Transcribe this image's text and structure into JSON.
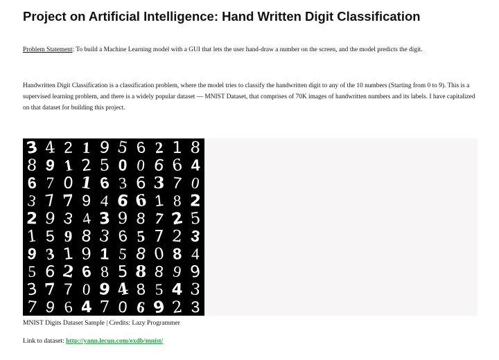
{
  "doc": {
    "title": "Project on Artificial Intelligence: Hand Written Digit Classification",
    "problem_label": "Problem Statement",
    "problem_text": ": To build a Machine Learning model with a GUI that lets the user hand-draw a number on the screen, and the model predicts the digit.",
    "description": "Handwritten Digit Classification is a classification problem, where the model tries to classify the handwritten digit to any of the 10 numbers (Starting from 0 to 9). This is a supervised learning problem, and there is a widely popular dataset — MNIST Dataset, that comprises of 70K images of handwritten numbers and its labels. I have capitalized on that dataset for building this project.",
    "caption": "MNIST Digits Dataset Sample | Credits: Lazy Programmer",
    "link_prefix": "Link to dataset: ",
    "link_text": "http://yann.lecun.com/exdb/mnist/"
  },
  "mnist_grid": {
    "rows": [
      [
        "3",
        "4",
        "2",
        "1",
        "9",
        "5",
        "6",
        "2",
        "1",
        "8"
      ],
      [
        "8",
        "9",
        "1",
        "2",
        "5",
        "0",
        "0",
        "6",
        "6",
        "4"
      ],
      [
        "6",
        "7",
        "0",
        "1",
        "6",
        "3",
        "6",
        "3",
        "7",
        "0"
      ],
      [
        "3",
        "7",
        "7",
        "9",
        "4",
        "6",
        "6",
        "1",
        "8",
        "2"
      ],
      [
        "2",
        "9",
        "3",
        "4",
        "3",
        "9",
        "8",
        "7",
        "2",
        "5"
      ],
      [
        "1",
        "5",
        "9",
        "8",
        "3",
        "6",
        "5",
        "7",
        "2",
        "3"
      ],
      [
        "9",
        "3",
        "1",
        "9",
        "1",
        "5",
        "8",
        "0",
        "8",
        "4"
      ],
      [
        "5",
        "6",
        "2",
        "6",
        "8",
        "5",
        "8",
        "8",
        "9",
        "9"
      ],
      [
        "3",
        "7",
        "7",
        "0",
        "9",
        "4",
        "8",
        "5",
        "4",
        "3"
      ],
      [
        "7",
        "9",
        "6",
        "4",
        "7",
        "0",
        "6",
        "9",
        "2",
        "3"
      ]
    ],
    "colors": {
      "background": "#000000",
      "digit": "#ffffff"
    }
  }
}
